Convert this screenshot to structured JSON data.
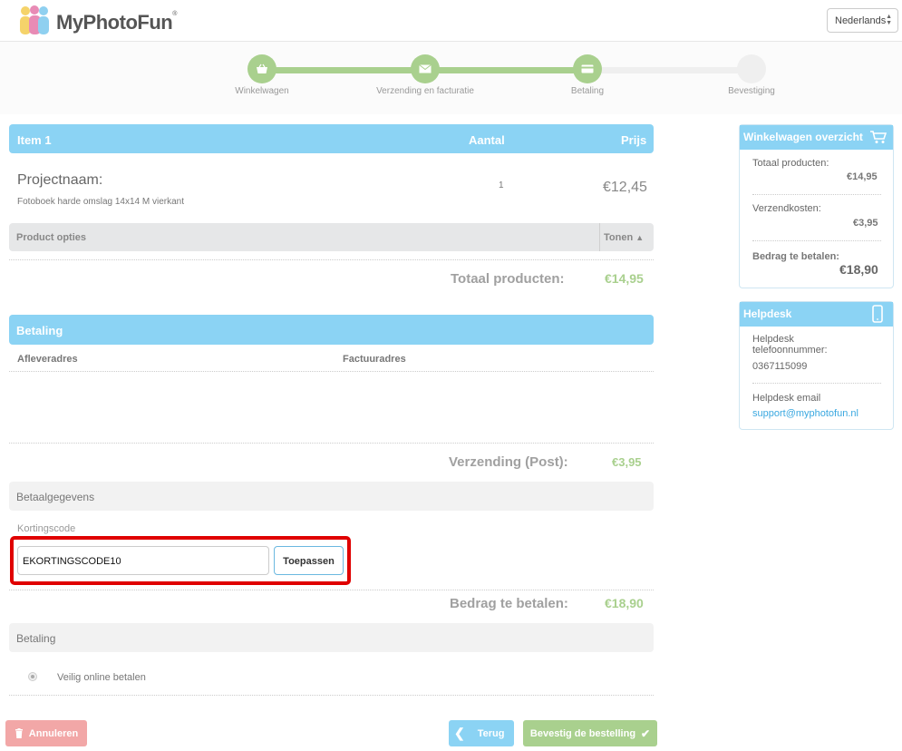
{
  "header": {
    "logo_text": "MyPhotoFun",
    "logo_mark": "®",
    "language": "Nederlands"
  },
  "steps": [
    {
      "label": "Winkelwagen",
      "icon": "basket-icon",
      "state": "done"
    },
    {
      "label": "Verzending en facturatie",
      "icon": "envelope-icon",
      "state": "done"
    },
    {
      "label": "Betaling",
      "icon": "credit-card-icon",
      "state": "done"
    },
    {
      "label": "Bevestiging",
      "icon": "",
      "state": "todo"
    }
  ],
  "cart": {
    "header_item": "Item 1",
    "header_qty": "Aantal",
    "header_price": "Prijs",
    "project_name": "Projectnaam:",
    "product_desc": "Fotoboek harde omslag 14x14 M vierkant",
    "quantity": "1",
    "price": "€12,45",
    "options_label": "Product opties",
    "show_label": "Tonen",
    "total_label": "Totaal producten:",
    "total_value": "€14,95"
  },
  "payment": {
    "header": "Betaling",
    "delivery_address_label": "Afleveradres",
    "invoice_address_label": "Factuuradres",
    "shipping_label": "Verzending (Post):",
    "shipping_value": "€3,95",
    "payment_details_label": "Betaalgegevens",
    "coupon_label": "Kortingscode",
    "coupon_value": "EKORTINGSCODE10",
    "apply_label": "Toepassen",
    "amount_label": "Bedrag te betalen:",
    "amount_value": "€18,90",
    "method_section_label": "Betaling",
    "method_option": "Veilig online betalen"
  },
  "actions": {
    "cancel_label": "Annuleren",
    "back_label": "Terug",
    "confirm_label": "Bevestig de bestelling"
  },
  "sidebar": {
    "overview_title": "Winkelwagen overzicht",
    "total_products_label": "Totaal producten:",
    "total_products_value": "€14,95",
    "shipping_label": "Verzendkosten:",
    "shipping_value": "€3,95",
    "amount_label": "Bedrag te betalen:",
    "amount_value": "€18,90",
    "helpdesk_title": "Helpdesk",
    "phone_label_1": "Helpdesk",
    "phone_label_2": "telefoonnummer:",
    "phone_value": "0367115099",
    "email_label": "Helpdesk email",
    "email_value": "support@myphotofun.nl"
  },
  "colors": {
    "accent_blue": "#8bd3f4",
    "accent_green": "#a9d08e",
    "cancel_red": "#f2a7a7",
    "highlight_red": "#e00000"
  }
}
